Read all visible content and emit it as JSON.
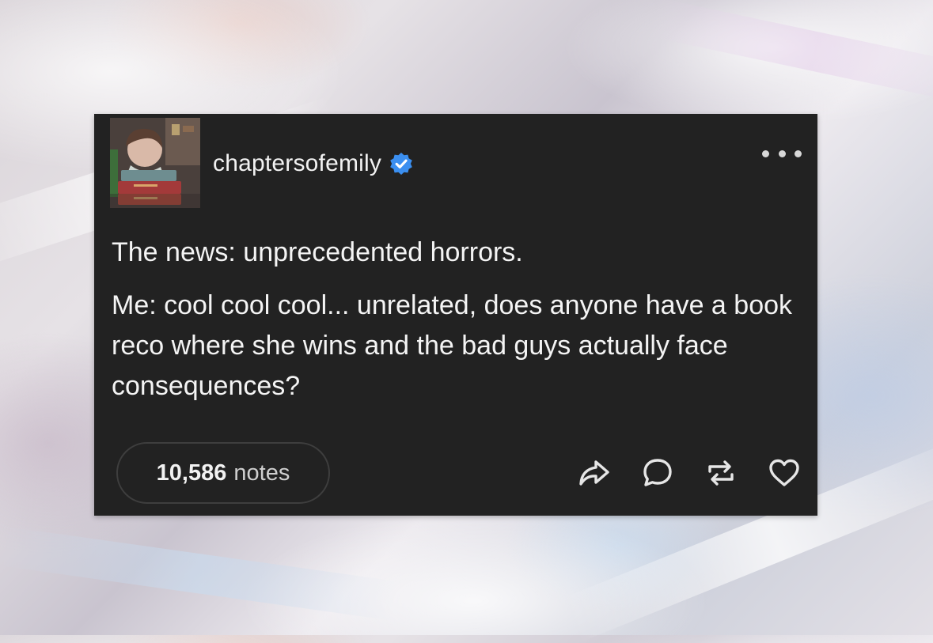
{
  "post": {
    "username": "chaptersofemily",
    "verified": true,
    "paragraphs": [
      "The news: unprecedented horrors.",
      "Me: cool cool cool... unrelated, does anyone have a book reco where she wins and the bad guys actually face consequences?"
    ],
    "notes": {
      "count": "10,586",
      "label": "notes"
    },
    "actions": [
      "share-icon",
      "reply-icon",
      "reblog-icon",
      "like-icon"
    ],
    "more_icon": "more-options-icon"
  },
  "colors": {
    "card_background": "#222222",
    "text": "#f4f4f4",
    "verified_badge": "#3b8ff0",
    "notes_border": "#3e3e3e"
  }
}
